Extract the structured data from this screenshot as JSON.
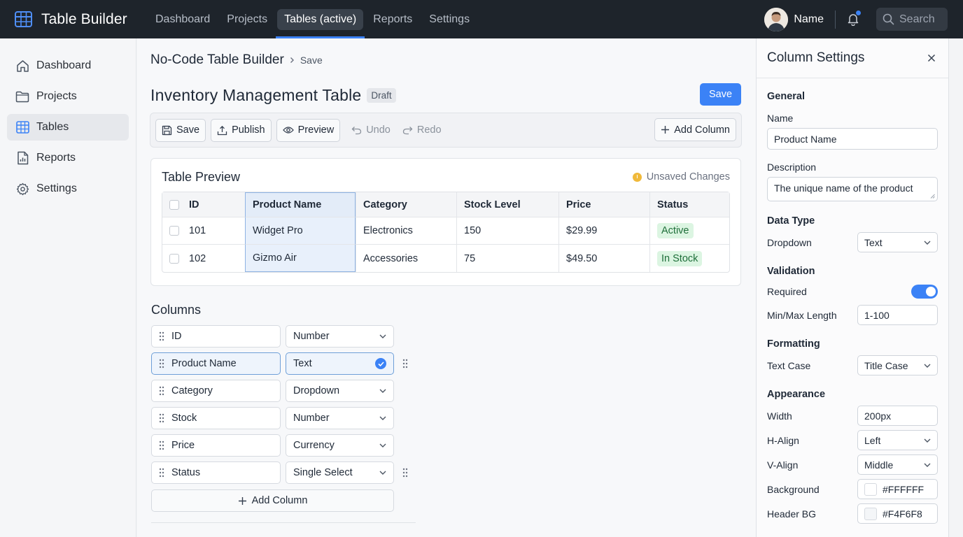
{
  "app": {
    "title": "Table Builder"
  },
  "topnav": [
    {
      "label": "Dashboard",
      "active": false
    },
    {
      "label": "Projects",
      "active": false
    },
    {
      "label": "Tables (active)",
      "active": true
    },
    {
      "label": "Reports",
      "active": false
    },
    {
      "label": "Settings",
      "active": false
    }
  ],
  "user": {
    "name": "Name"
  },
  "search": {
    "placeholder": "Search"
  },
  "sidebar": {
    "items": [
      {
        "label": "Dashboard",
        "icon": "home-icon",
        "active": false
      },
      {
        "label": "Projects",
        "icon": "folder-icon",
        "active": false
      },
      {
        "label": "Tables",
        "icon": "table-icon",
        "active": true
      },
      {
        "label": "Reports",
        "icon": "report-icon",
        "active": false
      },
      {
        "label": "Settings",
        "icon": "gear-icon",
        "active": false
      }
    ]
  },
  "breadcrumb": {
    "root": "No-Code Table Builder",
    "leaf": "Save"
  },
  "page": {
    "title": "Inventory Management Table",
    "badge": "Draft",
    "save_label": "Save"
  },
  "toolbar": {
    "save": "Save",
    "publish": "Publish",
    "preview": "Preview",
    "undo": "Undo",
    "redo": "Redo",
    "add_column": "Add Column"
  },
  "preview": {
    "title": "Table Preview",
    "status": "Unsaved Changes",
    "columns": [
      "ID",
      "Product Name",
      "Category",
      "Stock Level",
      "Price",
      "Status"
    ],
    "rows": [
      [
        "101",
        "Widget Pro",
        "Electronics",
        "150",
        "$29.99",
        "Active"
      ],
      [
        "102",
        "Gizmo Air",
        "Accessories",
        "75",
        "$49.50",
        "In Stock"
      ]
    ]
  },
  "columns_editor": {
    "title": "Columns",
    "items": [
      {
        "name": "ID",
        "type": "Number"
      },
      {
        "name": "Product Name",
        "type": "Text"
      },
      {
        "name": "Category",
        "type": "Dropdown"
      },
      {
        "name": "Stock",
        "type": "Number"
      },
      {
        "name": "Price",
        "type": "Currency"
      },
      {
        "name": "Status",
        "type": "Single Select"
      }
    ],
    "add_label": "Add Column"
  },
  "panel": {
    "title": "Column Settings",
    "general": "General",
    "name_label": "Name",
    "name_value": "Product Name",
    "desc_label": "Description",
    "desc_value": "The unique name of the product",
    "data_type": "Data Type",
    "dropdown_label": "Dropdown",
    "dropdown_value": "Text",
    "validation": "Validation",
    "required_label": "Required",
    "required_on": true,
    "minmax_label": "Min/Max Length",
    "minmax_value": "1-100",
    "formatting": "Formatting",
    "textcase_label": "Text Case",
    "textcase_value": "Title Case",
    "appearance": "Appearance",
    "width_label": "Width",
    "width_value": "200px",
    "halign_label": "H-Align",
    "halign_value": "Left",
    "valign_label": "V-Align",
    "valign_value": "Middle",
    "bg_label": "Background",
    "bg_value": "#FFFFFF",
    "headerbg_label": "Header BG",
    "headerbg_value": "#F4F6F8"
  },
  "colors": {
    "accent": "#3b82f6",
    "topbar": "#1e242b",
    "warning": "#f0b93a",
    "success_bg": "#dcf5e2"
  }
}
